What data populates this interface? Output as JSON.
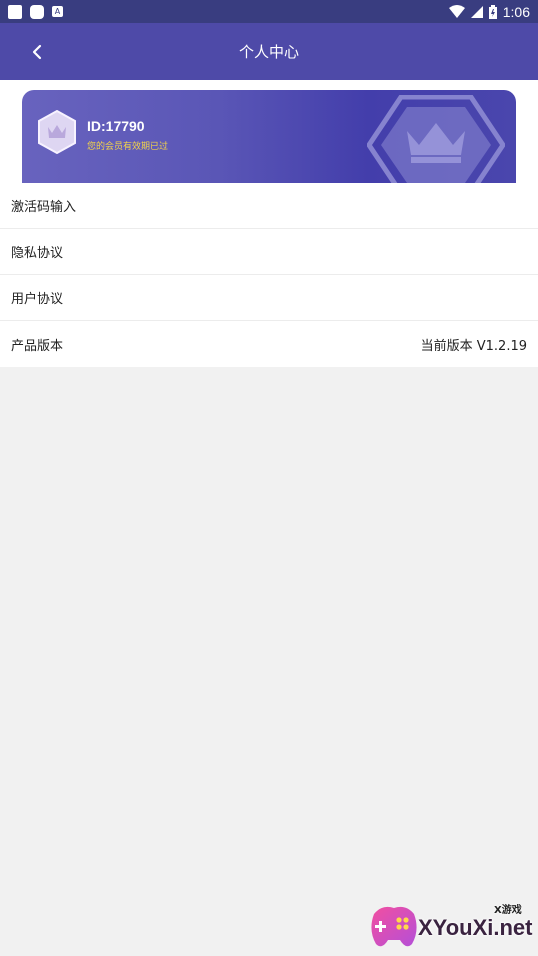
{
  "status_bar": {
    "time": "1:06"
  },
  "header": {
    "title": "个人中心"
  },
  "member_card": {
    "id_text": "ID:17790",
    "status_text": "您的会员有效期已过"
  },
  "menu": {
    "items": [
      {
        "label": "激活码输入",
        "value": ""
      },
      {
        "label": "隐私协议",
        "value": ""
      },
      {
        "label": "用户协议",
        "value": ""
      },
      {
        "label": "产品版本",
        "value": "当前版本 V1.2.19"
      }
    ]
  },
  "watermark": {
    "brand": "XYouXi.net",
    "small": "X游戏"
  },
  "colors": {
    "app_bar": "#4e4aa8",
    "status_bar": "#393d80",
    "accent_yellow": "#f2d34a"
  }
}
